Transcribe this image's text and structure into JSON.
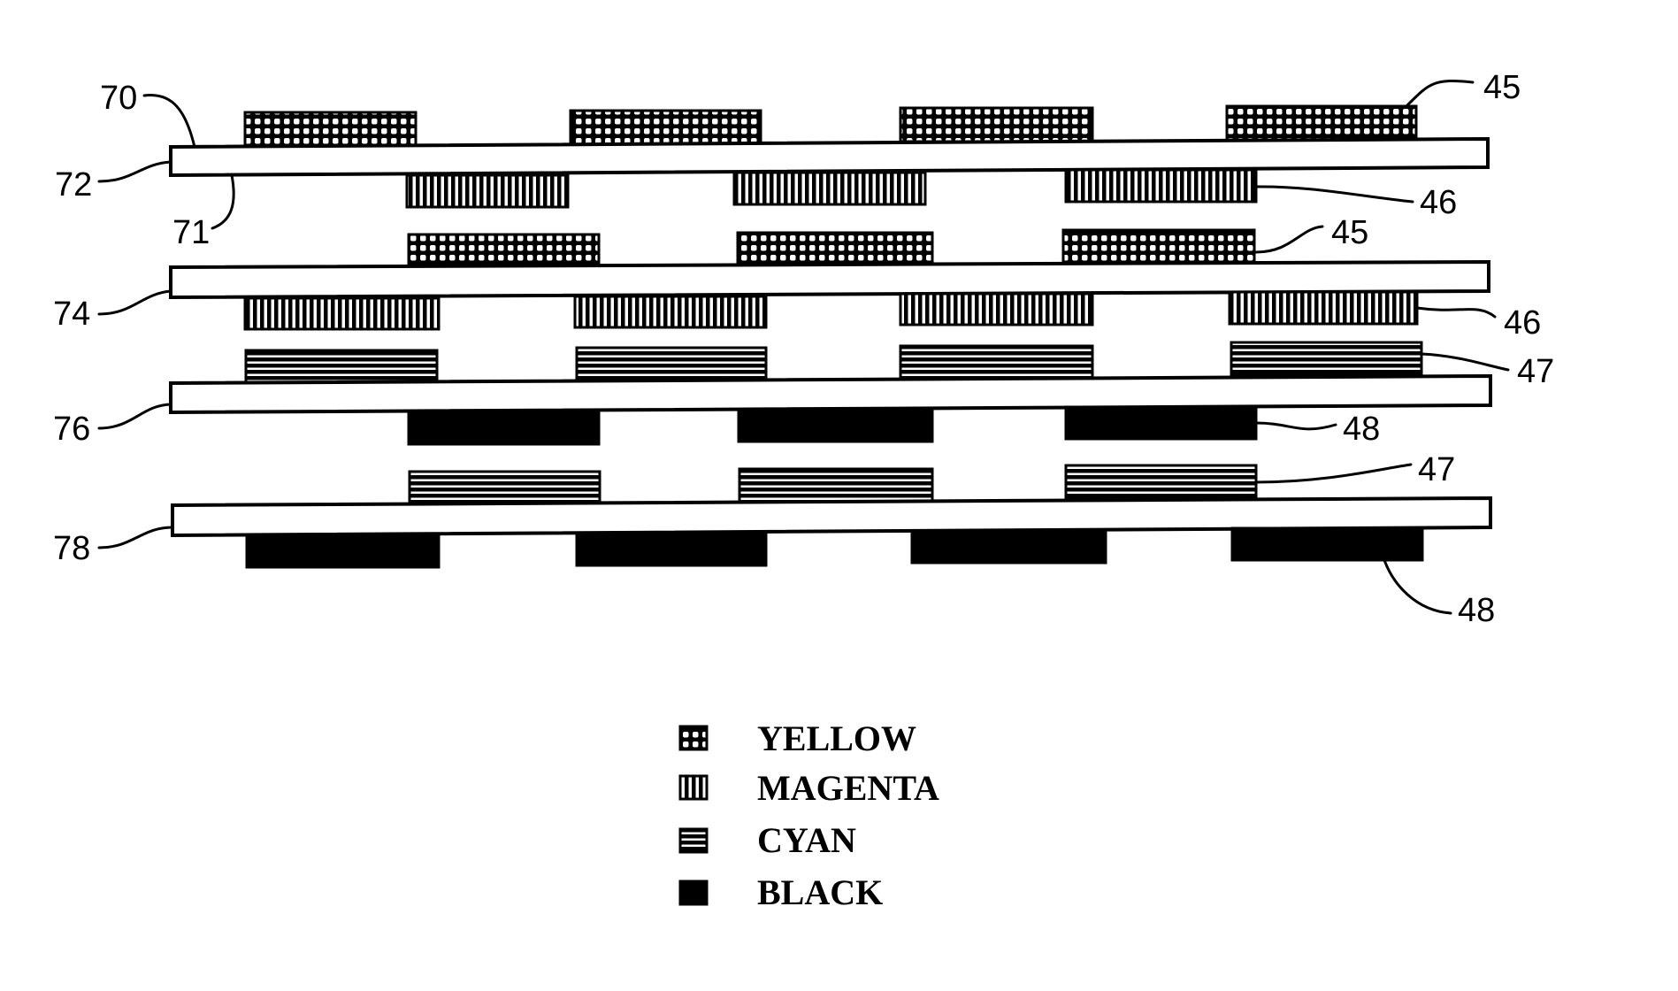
{
  "figure": {
    "description": "Stacked printing sheets with color toner pads on top and bottom faces",
    "legend": [
      {
        "key": "yellow",
        "label": "YELLOW",
        "pattern": "grid-dots"
      },
      {
        "key": "magenta",
        "label": "MAGENTA",
        "pattern": "vertical-lines"
      },
      {
        "key": "cyan",
        "label": "CYAN",
        "pattern": "horizontal-lines"
      },
      {
        "key": "black",
        "label": "BLACK",
        "pattern": "solid"
      }
    ],
    "sheets": [
      {
        "ref": "72",
        "top_color": "yellow",
        "bottom_color": "magenta"
      },
      {
        "ref": "74",
        "top_color": "yellow",
        "bottom_color": "magenta"
      },
      {
        "ref": "76",
        "top_color": "cyan",
        "bottom_color": "black"
      },
      {
        "ref": "78",
        "top_color": "cyan",
        "bottom_color": "black"
      }
    ],
    "reference_labels": {
      "top_surface": "70",
      "sheet_72": "72",
      "bottom_surface": "71",
      "sheet_74": "74",
      "sheet_76": "76",
      "sheet_78": "78",
      "yellow_pad_a": "45",
      "magenta_pad_a": "46",
      "yellow_pad_b": "45",
      "magenta_pad_b": "46",
      "cyan_pad_a": "47",
      "black_pad_a": "48",
      "cyan_pad_b": "47",
      "black_pad_b": "48"
    },
    "colors": {
      "ink": "#000000",
      "paper": "#ffffff"
    }
  }
}
